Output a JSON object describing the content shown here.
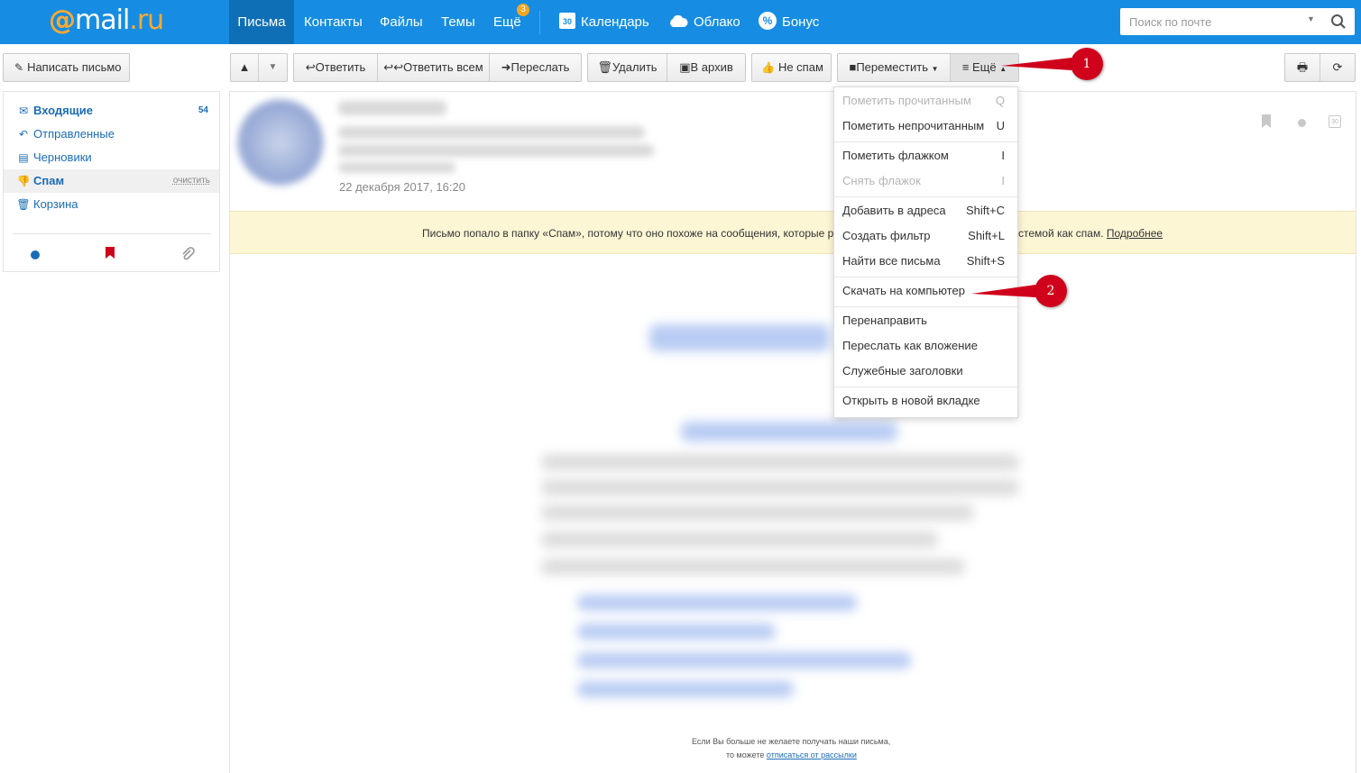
{
  "topbar": {
    "logo_at": "@",
    "logo_mail": "mail",
    "logo_ru": ".ru",
    "nav": {
      "letters": "Письма",
      "contacts": "Контакты",
      "files": "Файлы",
      "themes": "Темы",
      "more": "Ещё",
      "more_badge": "3",
      "calendar": "Календарь",
      "calendar_icon_day": "30",
      "cloud": "Облако",
      "bonus": "Бонус",
      "bonus_icon": "%"
    },
    "search_placeholder": "Поиск по почте"
  },
  "toolbar": {
    "compose": "Написать письмо",
    "reply": "Ответить",
    "reply_all": "Ответить всем",
    "forward": "Переслать",
    "delete": "Удалить",
    "archive": "В архив",
    "not_spam": "Не спам",
    "move": "Переместить",
    "more": "≡ Ещё"
  },
  "sidebar": {
    "folders": [
      {
        "label": "Входящие",
        "icon": "envelope-icon",
        "count": "54"
      },
      {
        "label": "Отправленные",
        "icon": "sent-arrow-icon"
      },
      {
        "label": "Черновики",
        "icon": "draft-icon"
      },
      {
        "label": "Спам",
        "icon": "thumbs-down-icon",
        "action": "очистить"
      },
      {
        "label": "Корзина",
        "icon": "trash-icon"
      }
    ]
  },
  "message": {
    "date": "22 декабря 2017, 16:20",
    "spam_notice_part1": "Письмо попало в папку «Спам», потому что оно похоже на сообщения, которые р",
    "spam_notice_part2": "стемой как спам.",
    "spam_more": "Подробнее",
    "footer_line1": "Если Вы больше не желаете получать наши письма,",
    "footer_line2_prefix": "то можете",
    "footer_unsubscribe": "отписаться от рассылки"
  },
  "menu": {
    "items": [
      {
        "label": "Пометить прочитанным",
        "key": "Q",
        "disabled": true
      },
      {
        "label": "Пометить непрочитанным",
        "key": "U",
        "disabled": false
      },
      {
        "label": "Пометить флажком",
        "key": "I",
        "disabled": false
      },
      {
        "label": "Снять флажок",
        "key": "I",
        "disabled": true
      },
      {
        "label": "Добавить в адреса",
        "key": "Shift+C",
        "disabled": false
      },
      {
        "label": "Создать фильтр",
        "key": "Shift+L",
        "disabled": false
      },
      {
        "label": "Найти все письма",
        "key": "Shift+S",
        "disabled": false
      },
      {
        "label": "Скачать на компьютер",
        "key": "",
        "disabled": false
      },
      {
        "label": "Перенаправить",
        "key": "",
        "disabled": false
      },
      {
        "label": "Переслать как вложение",
        "key": "",
        "disabled": false
      },
      {
        "label": "Служебные заголовки",
        "key": "",
        "disabled": false
      },
      {
        "label": "Открыть в новой вкладке",
        "key": "",
        "disabled": false
      }
    ]
  },
  "annotations": {
    "callout1": "1",
    "callout2": "2"
  },
  "colors": {
    "topbar": "#168de2",
    "active_nav": "#0f6fb6",
    "accent_orange": "#ffa930",
    "callout_red": "#d0021b",
    "spam_banner": "#fdf6d5"
  }
}
